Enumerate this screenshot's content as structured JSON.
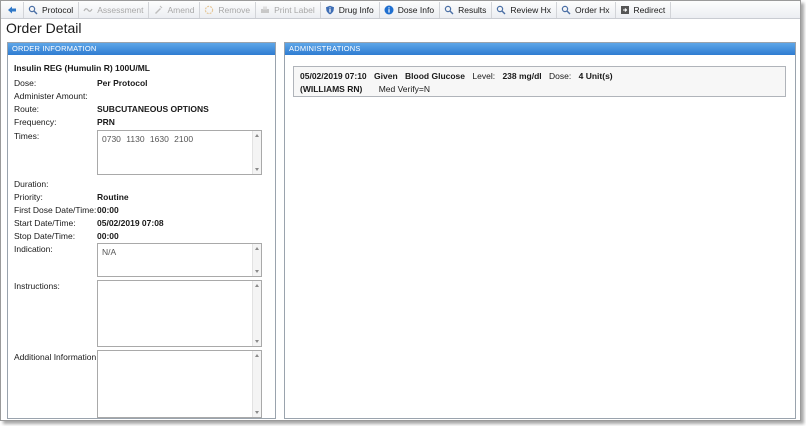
{
  "toolbar": {
    "buttons": [
      {
        "label": "Protocol",
        "enabled": true,
        "icon": "search-icon"
      },
      {
        "label": "Assessment",
        "enabled": false,
        "icon": "assessment-icon"
      },
      {
        "label": "Amend",
        "enabled": false,
        "icon": "amend-icon"
      },
      {
        "label": "Remove",
        "enabled": false,
        "icon": "remove-icon"
      },
      {
        "label": "Print Label",
        "enabled": false,
        "icon": "print-icon"
      },
      {
        "label": "Drug Info",
        "enabled": true,
        "icon": "shield-info-icon"
      },
      {
        "label": "Dose Info",
        "enabled": true,
        "icon": "info-icon"
      },
      {
        "label": "Results",
        "enabled": true,
        "icon": "search-icon"
      },
      {
        "label": "Review Hx",
        "enabled": true,
        "icon": "search-icon"
      },
      {
        "label": "Order Hx",
        "enabled": true,
        "icon": "search-icon"
      },
      {
        "label": "Redirect",
        "enabled": true,
        "icon": "redirect-icon"
      }
    ]
  },
  "page": {
    "title": "Order Detail"
  },
  "order_panel": {
    "header": "ORDER INFORMATION",
    "drug_name": "Insulin REG (Humulin R) 100U/ML",
    "fields": {
      "dose": {
        "label": "Dose:",
        "value": "Per Protocol"
      },
      "administer_amount": {
        "label": "Administer Amount:",
        "value": ""
      },
      "route": {
        "label": "Route:",
        "value": "SUBCUTANEOUS OPTIONS"
      },
      "frequency": {
        "label": "Frequency:",
        "value": "PRN"
      },
      "times": {
        "label": "Times:",
        "value": "0730 1130 1630 2100"
      },
      "duration": {
        "label": "Duration:",
        "value": ""
      },
      "priority": {
        "label": "Priority:",
        "value": "Routine"
      },
      "first_dose": {
        "label": "First Dose Date/Time:",
        "value": "00:00"
      },
      "start": {
        "label": "Start Date/Time:",
        "value": "05/02/2019 07:08"
      },
      "stop": {
        "label": "Stop Date/Time:",
        "value": "00:00"
      },
      "indication": {
        "label": "Indication:",
        "value": "N/A"
      },
      "instructions": {
        "label": "Instructions:",
        "value": ""
      },
      "additional_info": {
        "label": "Additional Information:",
        "value": ""
      }
    }
  },
  "admin_panel": {
    "header": "ADMINISTRATIONS",
    "entries": [
      {
        "datetime": "05/02/2019 07:10",
        "status": "Given",
        "test": "Blood Glucose",
        "level_label": "Level:",
        "level_value": "238 mg/dl",
        "dose_label": "Dose:",
        "dose_value": "4 Unit(s)",
        "nurse": "(WILLIAMS RN)",
        "verify": "Med Verify=N"
      }
    ]
  },
  "colors": {
    "panel_header_top": "#5ea6e8",
    "panel_header_bottom": "#2f7cd1",
    "disabled_text": "#a8a8a8"
  }
}
